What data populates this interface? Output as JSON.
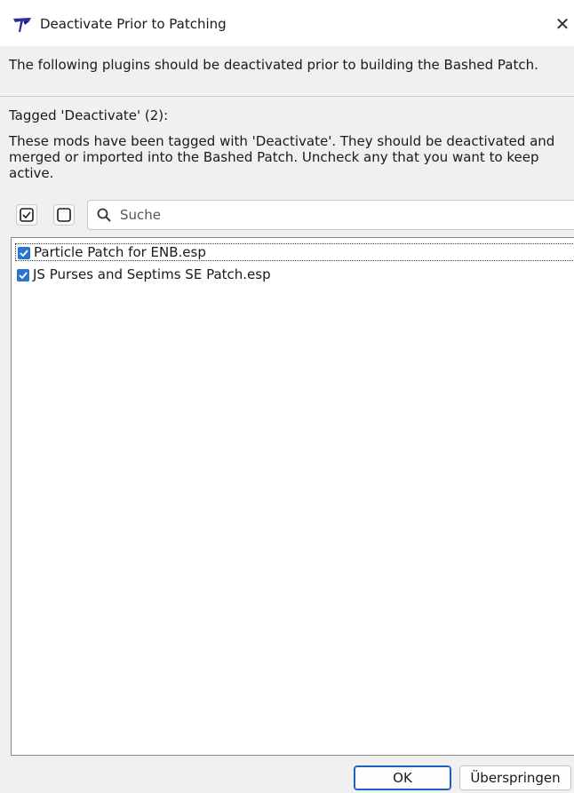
{
  "window": {
    "title": "Deactivate Prior to Patching",
    "close_glyph": "✕"
  },
  "header": {
    "description": "The following plugins should be deactivated prior to building the Bashed Patch."
  },
  "group": {
    "label": "Tagged 'Deactivate' (2):",
    "description": "These mods have been tagged with 'Deactivate'. They should be deactivated and merged or imported into the Bashed Patch. Uncheck any that you want to keep active."
  },
  "toolbar": {
    "check_all_icon": "checked-box-icon",
    "uncheck_all_icon": "empty-box-icon"
  },
  "search": {
    "placeholder": "Suche",
    "value": ""
  },
  "plugins": [
    {
      "name": "Particle Patch for ENB.esp",
      "checked": true
    },
    {
      "name": "JS Purses and Septims SE Patch.esp",
      "checked": true
    }
  ],
  "buttons": {
    "ok_label": "OK",
    "skip_label": "Überspringen"
  },
  "colors": {
    "accent": "#2a73cf",
    "background": "#f0f0f0"
  }
}
